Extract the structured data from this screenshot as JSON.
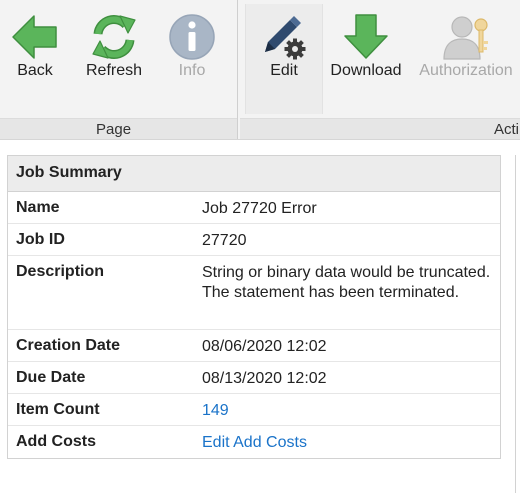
{
  "ribbon": {
    "page_group": {
      "label": "Page",
      "buttons": {
        "back": "Back",
        "refresh": "Refresh",
        "info": "Info"
      }
    },
    "actions_group": {
      "label": "Acti",
      "buttons": {
        "edit": "Edit",
        "download": "Download",
        "authorization": "Authorization"
      }
    }
  },
  "colors": {
    "back_arrow": "#5bb55b",
    "refresh_arrows": "#5bb55b",
    "info_disabled": "#a9b6c6",
    "edit_pencil": "#2f4a6e",
    "download_arrow": "#5bb55b",
    "authorization_disabled": "#c8c8c8",
    "link": "#1a73c9"
  },
  "job_summary": {
    "title": "Job Summary",
    "rows": [
      {
        "key": "Name",
        "value": "Job 27720 Error"
      },
      {
        "key": "Job ID",
        "value": "27720"
      },
      {
        "key": "Description",
        "value": "String or binary data would be truncated. The statement has been terminated."
      },
      {
        "key": "Creation Date",
        "value": "08/06/2020 12:02"
      },
      {
        "key": "Due Date",
        "value": "08/13/2020 12:02"
      },
      {
        "key": "Item Count",
        "value": "149"
      },
      {
        "key": "Add Costs",
        "value": "Edit Add Costs"
      }
    ]
  }
}
